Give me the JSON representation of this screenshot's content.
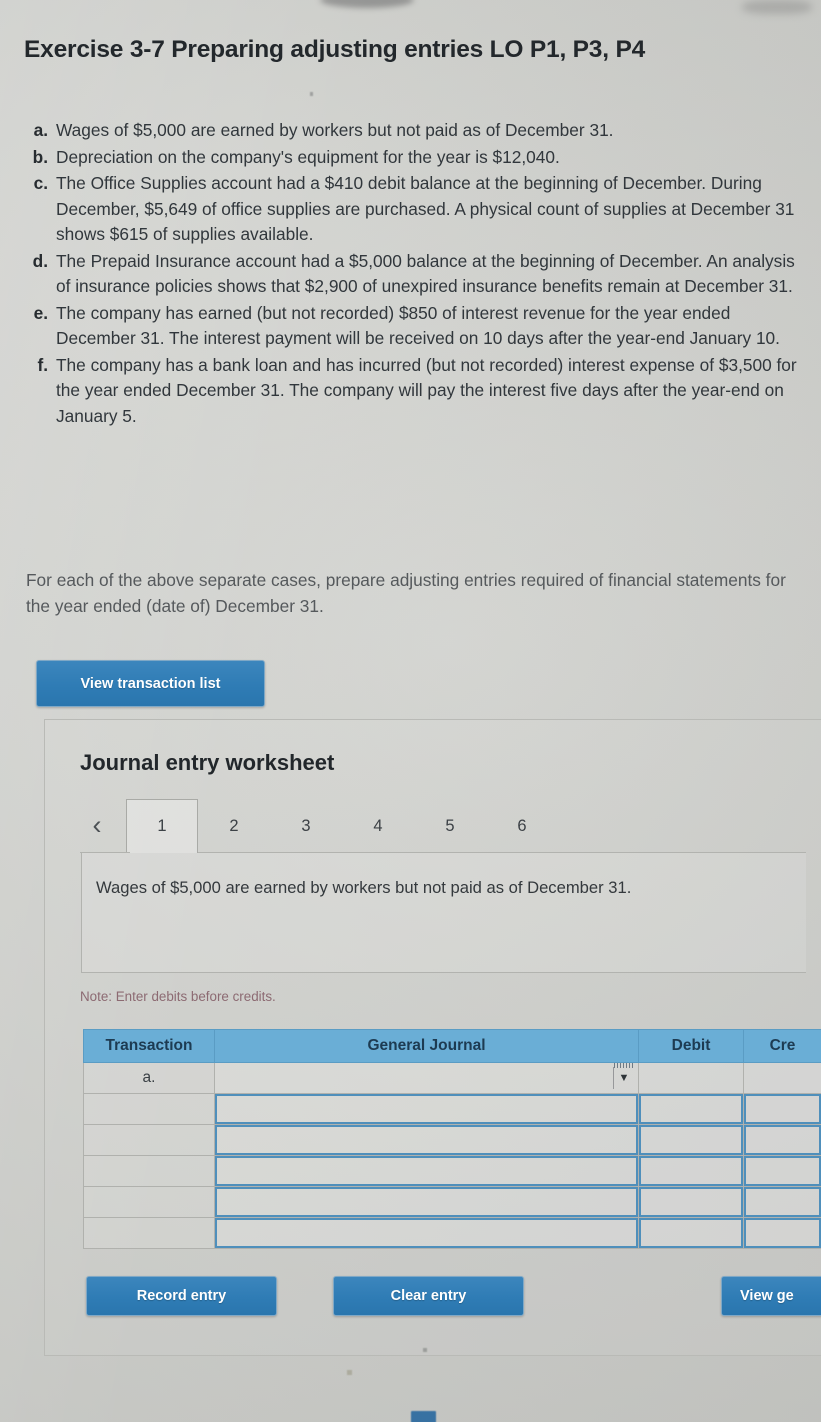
{
  "exercise": {
    "title": "Exercise 3-7 Preparing adjusting entries LO P1, P3, P4",
    "cases": [
      {
        "marker": "a.",
        "text": "Wages of $5,000 are earned by workers but not paid as of December 31."
      },
      {
        "marker": "b.",
        "text": "Depreciation on the company's equipment for the year is $12,040."
      },
      {
        "marker": "c.",
        "text": "The Office Supplies account had a $410 debit balance at the beginning of December. During December, $5,649 of office supplies are purchased. A physical count of supplies at December 31 shows $615 of supplies available."
      },
      {
        "marker": "d.",
        "text": "The Prepaid Insurance account had a $5,000 balance at the beginning of December. An analysis of insurance policies shows that $2,900 of unexpired insurance benefits remain at December 31."
      },
      {
        "marker": "e.",
        "text": "The company has earned (but not recorded) $850 of interest revenue for the year ended December 31. The interest payment will be received on 10 days after the year-end January 10."
      },
      {
        "marker": "f.",
        "text": "The company has a bank loan and has incurred (but not recorded) interest expense of $3,500 for the year ended December 31. The company will pay the interest five days after the year-end on January 5."
      }
    ],
    "instructions": "For each of the above separate cases, prepare adjusting entries required of financial statements for the year ended (date of) December 31.",
    "view_transaction_list_label": "View transaction list"
  },
  "worksheet": {
    "title": "Journal entry worksheet",
    "prev_icon": "‹",
    "tabs": [
      {
        "label": "1",
        "active": true
      },
      {
        "label": "2",
        "active": false
      },
      {
        "label": "3",
        "active": false
      },
      {
        "label": "4",
        "active": false
      },
      {
        "label": "5",
        "active": false
      },
      {
        "label": "6",
        "active": false
      }
    ],
    "transaction_description": "Wages of $5,000 are earned by workers but not paid as of December 31.",
    "note": "Note: Enter debits before credits.",
    "table": {
      "headers": [
        "Transaction",
        "General Journal",
        "Debit",
        "Cre"
      ],
      "rows": [
        {
          "transaction": "a.",
          "general_journal": "",
          "debit": "",
          "credit": "",
          "has_dropdown": true
        },
        {
          "transaction": "",
          "general_journal": "",
          "debit": "",
          "credit": "",
          "has_dropdown": false
        },
        {
          "transaction": "",
          "general_journal": "",
          "debit": "",
          "credit": "",
          "has_dropdown": false
        },
        {
          "transaction": "",
          "general_journal": "",
          "debit": "",
          "credit": "",
          "has_dropdown": false
        },
        {
          "transaction": "",
          "general_journal": "",
          "debit": "",
          "credit": "",
          "has_dropdown": false
        },
        {
          "transaction": "",
          "general_journal": "",
          "debit": "",
          "credit": "",
          "has_dropdown": false
        }
      ]
    },
    "actions": {
      "record_entry": "Record entry",
      "clear_entry": "Clear entry",
      "view_general_journal": "View ge"
    },
    "caret_icon": "▼"
  },
  "colors": {
    "button_blue": "#2f7cb5",
    "table_header_blue": "#6aaed6",
    "note_text": "#8c6a72",
    "page_background": "#d2d3cf",
    "input_border_blue": "#4f8fbb"
  }
}
